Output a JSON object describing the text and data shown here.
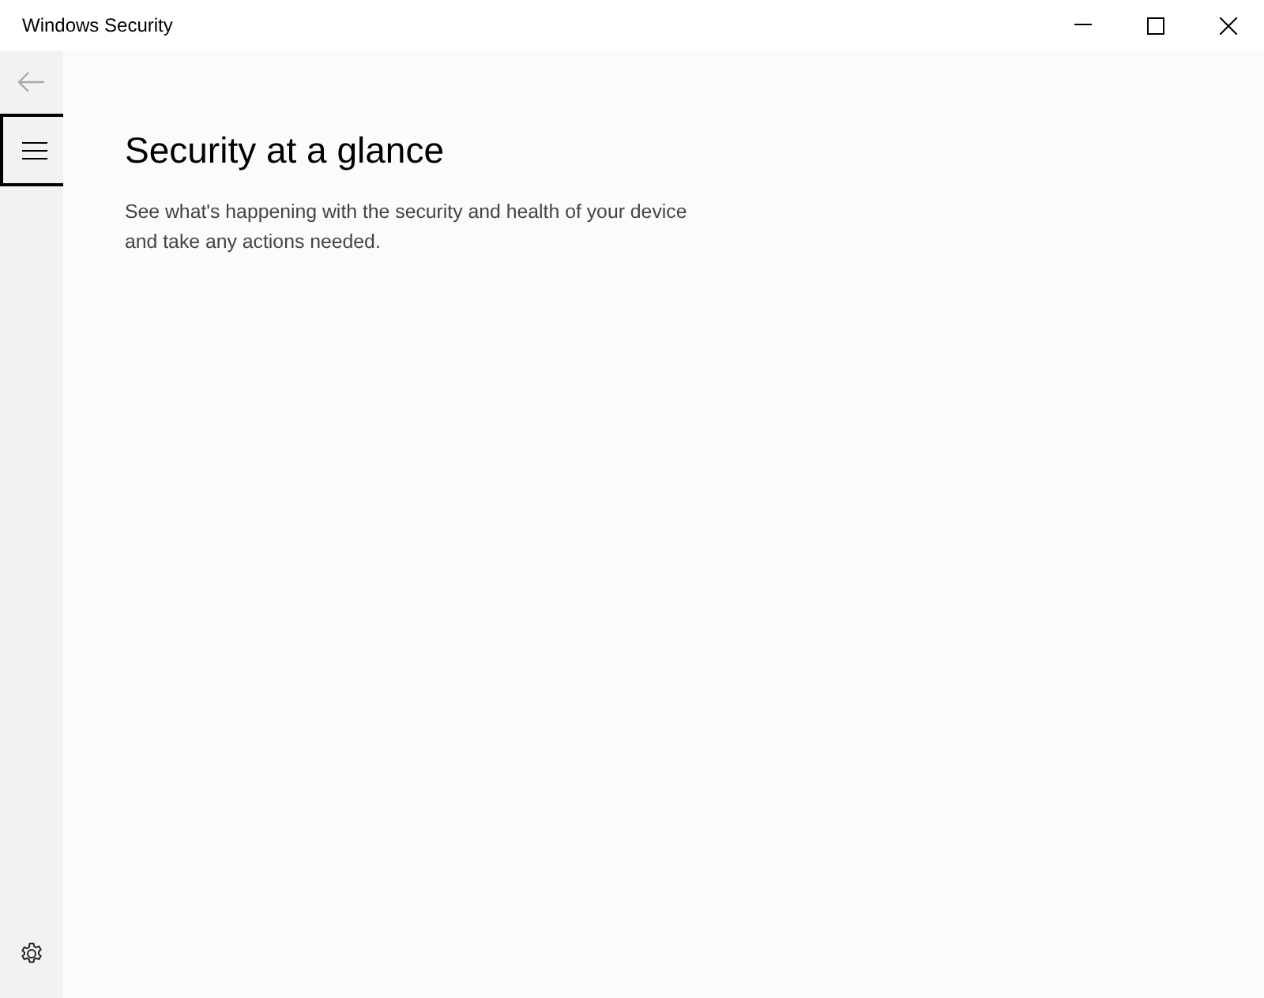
{
  "window": {
    "title": "Windows Security"
  },
  "nav": {
    "back_disabled": true,
    "menu_focused": true
  },
  "page": {
    "heading": "Security at a glance",
    "description": "See what's happening with the security and health of your device and take any actions needed."
  }
}
